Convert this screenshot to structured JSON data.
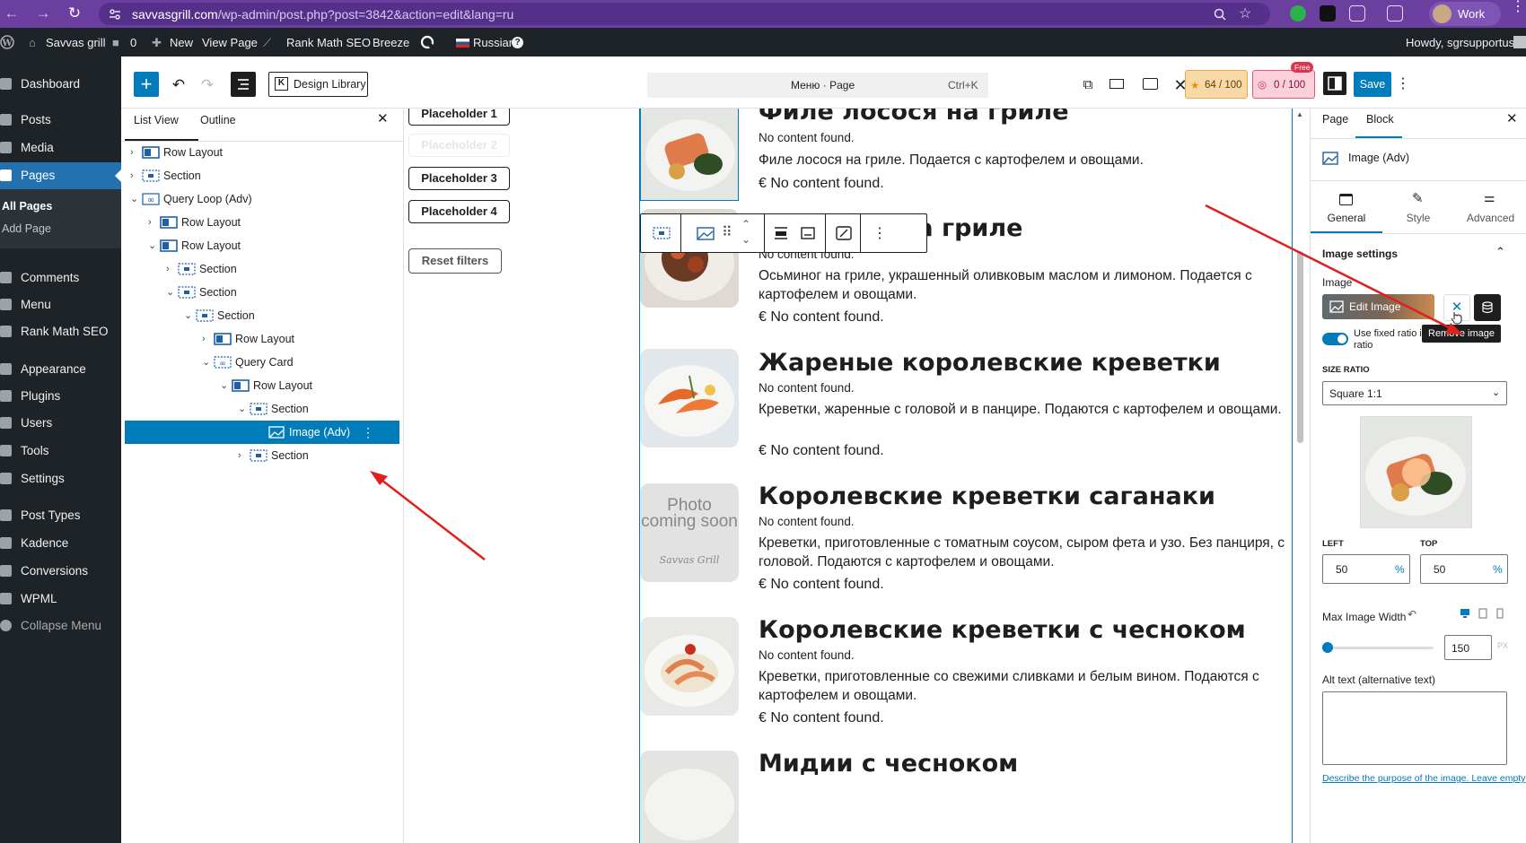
{
  "browser": {
    "url_main": "savvasgrill.com",
    "url_rest": "/wp-admin/post.php?post=3842&action=edit&lang=ru",
    "profile_label": "Work"
  },
  "adminbar": {
    "site_name": "Savvas grill",
    "comments_count": "0",
    "new_label": "New",
    "view_page": "View Page",
    "rank_math": "Rank Math SEO",
    "breeze": "Breeze",
    "language": "Russian",
    "howdy": "Howdy, sgrsupportusr"
  },
  "sidebar": {
    "items": [
      {
        "label": "Dashboard"
      },
      {
        "label": "Posts"
      },
      {
        "label": "Media"
      },
      {
        "label": "Pages"
      },
      {
        "label": "Comments"
      },
      {
        "label": "Menu"
      },
      {
        "label": "Rank Math SEO"
      },
      {
        "label": "Appearance"
      },
      {
        "label": "Plugins"
      },
      {
        "label": "Users"
      },
      {
        "label": "Tools"
      },
      {
        "label": "Settings"
      },
      {
        "label": "Post Types"
      },
      {
        "label": "Kadence"
      },
      {
        "label": "Conversions"
      },
      {
        "label": "WPML"
      },
      {
        "label": "Collapse Menu"
      }
    ],
    "sub_all_pages": "All Pages",
    "sub_add_page": "Add Page"
  },
  "editor": {
    "design_library": "Design Library",
    "doc_title": "Меню · Page",
    "shortcut": "Ctrl+K",
    "score1": "64 / 100",
    "score2": "0 / 100",
    "free_badge": "Free",
    "save_label": "Save"
  },
  "listview": {
    "tab_list": "List View",
    "tab_outline": "Outline",
    "rows": [
      {
        "label": "Row Layout"
      },
      {
        "label": "Section"
      },
      {
        "label": "Query Loop (Adv)"
      },
      {
        "label": "Row Layout"
      },
      {
        "label": "Row Layout"
      },
      {
        "label": "Section"
      },
      {
        "label": "Section"
      },
      {
        "label": "Section"
      },
      {
        "label": "Row Layout"
      },
      {
        "label": "Query Card"
      },
      {
        "label": "Row Layout"
      },
      {
        "label": "Section"
      },
      {
        "label": "Image (Adv)"
      },
      {
        "label": "Section"
      }
    ]
  },
  "canvas": {
    "placeholders": [
      "Placeholder 1",
      "Placeholder 2",
      "Placeholder 3",
      "Placeholder 4"
    ],
    "reset_filters": "Reset filters",
    "no_content": "No content found.",
    "price": "€ No content found.",
    "photo_placeholder": "Photo coming soon",
    "photo_brand": "Savvas Grill",
    "cards": [
      {
        "title": "Филе лосося на гриле",
        "desc": "Филе лосося на гриле. Подается с картофелем и овощами.",
        "image": "salmon"
      },
      {
        "title": "Осьминог на гриле",
        "desc": "Осьминог на гриле, украшенный оливковым маслом и лимоном. Подается с картофелем и овощами.",
        "image": "octopus"
      },
      {
        "title": "Жареные королевские креветки",
        "desc": "Креветки, жаренные с головой и в панцире. Подаются с картофелем и овощами.",
        "image": "shrimp"
      },
      {
        "title": "Королевские креветки саганаки",
        "desc": "Креветки, приготовленные с томатным соусом, сыром фета и узо. Без панциря, с головой. Подаются с картофелем и овощами.",
        "image": "placeholder"
      },
      {
        "title": "Королевские креветки с чесноком",
        "desc": "Креветки, приготовленные со свежими сливками и белым вином. Подаются с картофелем и овощами.",
        "image": "garlic-shrimp"
      },
      {
        "title": "Мидии с чесноком",
        "desc": "",
        "image": "mussels"
      }
    ]
  },
  "inspector": {
    "tab_page": "Page",
    "tab_block": "Block",
    "block_name": "Image (Adv)",
    "subtab_general": "General",
    "subtab_style": "Style",
    "subtab_advanced": "Advanced",
    "section_title": "Image settings",
    "image_label": "Image",
    "edit_image": "Edit Image",
    "tooltip_remove": "Remove image",
    "toggle_label_1": "Use fixed ratio i",
    "toggle_label_2": "ratio",
    "size_ratio_label": "SIZE RATIO",
    "size_ratio_value": "Square 1:1",
    "left_label": "LEFT",
    "left_value": "50",
    "top_label": "TOP",
    "top_value": "50",
    "percent": "%",
    "max_width_label": "Max Image Width",
    "max_width_value": "150",
    "px": "PX",
    "max_width_fill": 0.05,
    "alt_label": "Alt text (alternative text)",
    "alt_help": "Describe the purpose of the image. Leave empty"
  },
  "colors": {
    "wp_blue": "#007cba",
    "admin_dark": "#1d2327",
    "chrome_purple": "#6b3fa0",
    "arrow_red": "#e0201c"
  }
}
